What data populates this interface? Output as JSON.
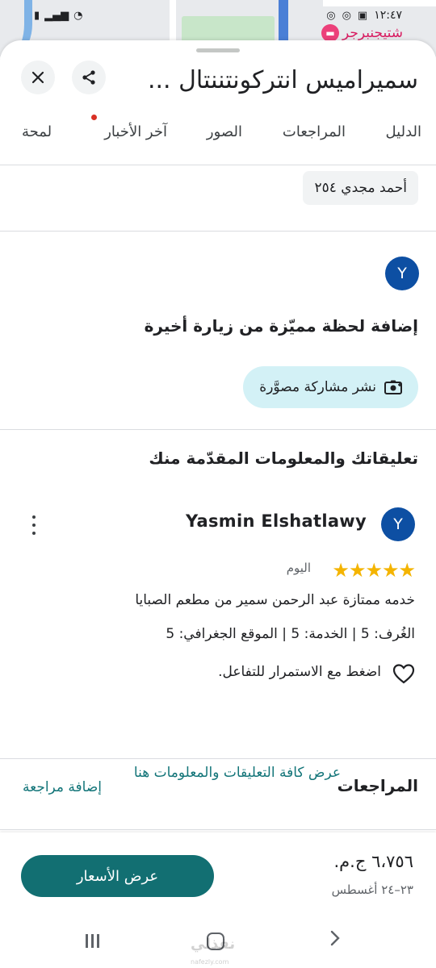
{
  "status_bar": {
    "time": "١٢:٤٧",
    "poi_label": "شتيجنبرجر"
  },
  "header": {
    "title": "سميراميس انتركونتننتال ...",
    "close_icon": "close-icon",
    "share_icon": "share-icon"
  },
  "tabs": [
    {
      "label": "الدليل"
    },
    {
      "label": "المراجعات"
    },
    {
      "label": "الصور"
    },
    {
      "label": "آخر الأخبار",
      "has_notification": true
    },
    {
      "label": "لمحة"
    }
  ],
  "chip": {
    "label": "أحمد مجدي ٢٥٤"
  },
  "user_avatar": {
    "initial": "Y",
    "color": "#0d4fa3"
  },
  "add_moment": {
    "heading": "إضافة لحظة مميّزة من زيارة أخيرة",
    "post_button": "نشر مشاركة مصوَّرة"
  },
  "contributions": {
    "heading": "تعليقاتك والمعلومات المقدّمة منك",
    "review": {
      "avatar_initial": "Y",
      "author": "Yasmin Elshatlawy",
      "stars": "★★★★★",
      "rating": 5,
      "time": "اليوم",
      "text": "خدمه ممتازة عبد الرحمن سمير من مطعم الصبايا",
      "ratings_line": "الغُرف: 5 | الخدمة: 5 | الموقع الجغرافي: 5",
      "react_prompt": "اضغط مع الاستمرار للتفاعل."
    },
    "view_all_link": "عرض كافة التعليقات والمعلومات هنا"
  },
  "reviews_section": {
    "title": "المراجعات",
    "add_review": "إضافة مراجعة"
  },
  "price_bar": {
    "price": "٦،٧٥٦ ج.م.",
    "dates": "٢٣–٢٤ أغسطس",
    "button_label": "عرض الأسعار"
  },
  "watermark": {
    "text": "نفذلي",
    "sub": "nafezly.com"
  },
  "colors": {
    "accent_teal": "#126f72",
    "link_teal": "#137579",
    "star_yellow": "#f4b400",
    "post_chip_bg": "#d3f1f6"
  }
}
